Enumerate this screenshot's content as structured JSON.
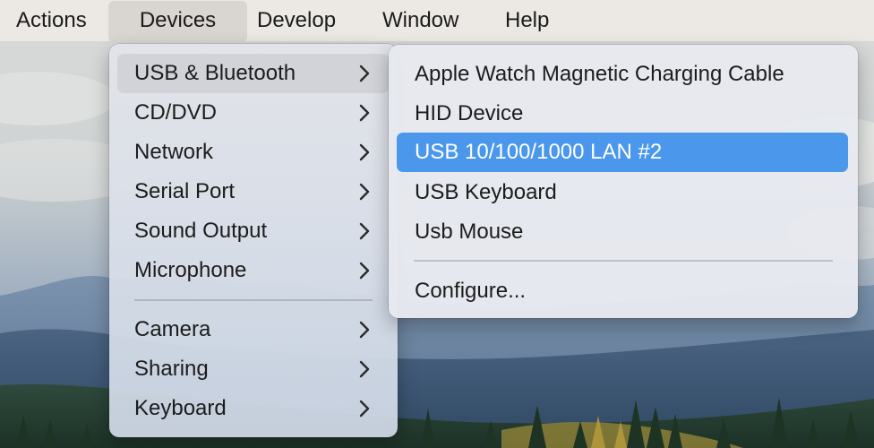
{
  "menubar": {
    "items": [
      {
        "label": "Actions"
      },
      {
        "label": "Devices",
        "active": true
      },
      {
        "label": "Develop"
      },
      {
        "label": "Window"
      },
      {
        "label": "Help"
      }
    ]
  },
  "devices_menu": {
    "items": [
      {
        "label": "USB & Bluetooth",
        "submenu": true,
        "highlighted": true
      },
      {
        "label": "CD/DVD",
        "submenu": true
      },
      {
        "label": "Network",
        "submenu": true
      },
      {
        "label": "Serial Port",
        "submenu": true
      },
      {
        "label": "Sound Output",
        "submenu": true
      },
      {
        "label": "Microphone",
        "submenu": true
      },
      {
        "label": "Camera",
        "submenu": true
      },
      {
        "label": "Sharing",
        "submenu": true
      },
      {
        "label": "Keyboard",
        "submenu": true
      }
    ]
  },
  "usb_submenu": {
    "items": [
      {
        "label": "Apple Watch Magnetic Charging Cable"
      },
      {
        "label": "HID Device"
      },
      {
        "label": "USB 10/100/1000 LAN #2",
        "selected": true
      },
      {
        "label": "USB Keyboard"
      },
      {
        "label": "Usb Mouse"
      },
      {
        "label": "Configure..."
      }
    ]
  },
  "colors": {
    "selection_accent": "#4a97ec",
    "hover_gray": "#d2d3d8",
    "menubar_bg": "#ece9e4"
  },
  "icons": {
    "submenu_indicator": "chevron-right-icon"
  }
}
